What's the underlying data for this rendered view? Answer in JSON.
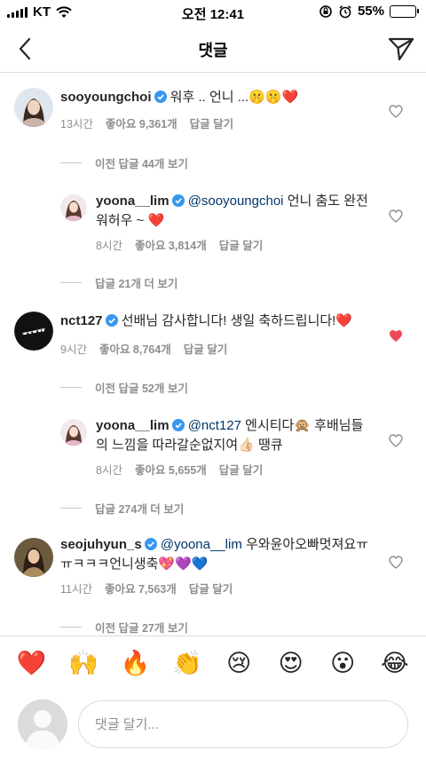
{
  "status": {
    "carrier": "KT",
    "time": "오전 12:41",
    "battery": "55%",
    "battery_level": 0.55
  },
  "header": {
    "title": "댓글"
  },
  "comments": [
    {
      "username": "sooyoungchoi",
      "mention": "",
      "text": "워후 .. 언니 ...🤫🤫❤️",
      "time": "13시간",
      "likes": "좋아요 9,361개",
      "reply": "답글 달기",
      "liked": false
    },
    {
      "username": "yoona__lim",
      "mention": "@sooyoungchoi",
      "text": "언니 춤도 완전 워허우 ~ ❤️",
      "time": "8시간",
      "likes": "좋아요 3,814개",
      "reply": "답글 달기",
      "liked": false
    },
    {
      "username": "nct127",
      "mention": "",
      "text": "선배님 감사합니다! 생일 축하드립니다!❤️",
      "time": "9시간",
      "likes": "좋아요 8,764개",
      "reply": "답글 달기",
      "liked": true
    },
    {
      "username": "yoona__lim",
      "mention": "@nct127",
      "text": "엔시티다🙊 후배님들의 느낌을 따라갈순없지여👍🏻 땡큐",
      "time": "8시간",
      "likes": "좋아요 5,655개",
      "reply": "답글 달기",
      "liked": false
    },
    {
      "username": "seojuhyun_s",
      "mention": "@yoona__lim",
      "text": "우와윤아오빠멋져요ㅠㅠㅋㅋㅋ언니생축💖💜💙",
      "time": "11시간",
      "likes": "좋아요 7,563개",
      "reply": "답글 달기",
      "liked": false
    }
  ],
  "reply_links": [
    "이전 답글 44개 보기",
    "답글 21개 더 보기",
    "이전 답글 52개 보기",
    "답글 274개 더 보기",
    "이전 답글 27개 보기"
  ],
  "emoji_bar": [
    "❤️",
    "🙌",
    "🔥",
    "👏",
    "😢",
    "😍",
    "😮",
    "😂"
  ],
  "input": {
    "placeholder": "댓글 달기..."
  },
  "colors": {
    "verified": "#3897f0",
    "liked_heart": "#ed4956",
    "meta_gray": "#8e8e8e"
  }
}
